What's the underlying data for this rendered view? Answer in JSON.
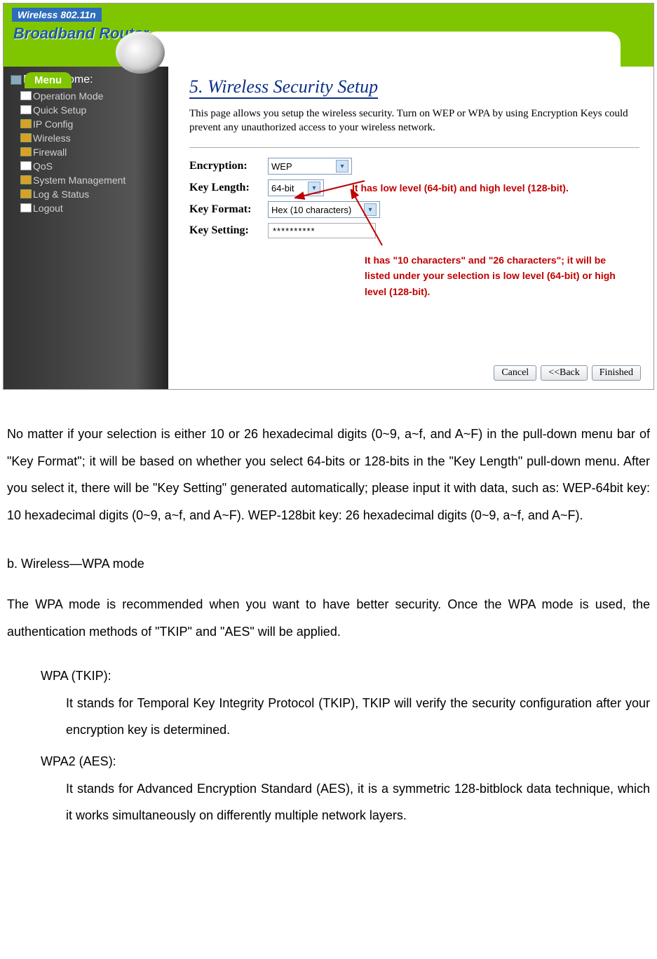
{
  "banner": {
    "line1": "Wireless 802.11n",
    "line2": "Broadband Router",
    "menu_label": "Menu"
  },
  "sidebar": {
    "title": "Router Home:",
    "items": [
      {
        "label": "Operation Mode",
        "icon": "page"
      },
      {
        "label": "Quick Setup",
        "icon": "page"
      },
      {
        "label": "IP Config",
        "icon": "folder"
      },
      {
        "label": "Wireless",
        "icon": "folder"
      },
      {
        "label": "Firewall",
        "icon": "folder"
      },
      {
        "label": "QoS",
        "icon": "page"
      },
      {
        "label": "System Management",
        "icon": "folder"
      },
      {
        "label": "Log & Status",
        "icon": "folder"
      },
      {
        "label": "Logout",
        "icon": "page"
      }
    ]
  },
  "section": {
    "title": "5. Wireless Security Setup",
    "description": "This page allows you setup the wireless security. Turn on WEP or WPA by using Encryption Keys could prevent any unauthorized access to your wireless network."
  },
  "form": {
    "encryption": {
      "label": "Encryption:",
      "value": "WEP"
    },
    "key_length": {
      "label": "Key Length:",
      "value": "64-bit"
    },
    "key_format": {
      "label": "Key Format:",
      "value": "Hex (10 characters)"
    },
    "key_setting": {
      "label": "Key Setting:",
      "value": "**********"
    }
  },
  "callouts": {
    "c1": "It has low level (64-bit) and high level (128-bit).",
    "c2": "It has \"10 characters\" and \"26 characters\"; it will be listed under your selection is low level (64-bit) or high level (128-bit)."
  },
  "buttons": {
    "cancel": "Cancel",
    "back": "<<Back",
    "finished": "Finished"
  },
  "doc": {
    "p1": "No matter if your selection is either 10 or 26 hexadecimal digits (0~9, a~f, and A~F) in the pull-down menu bar of \"Key Format\"; it will be based on whether you select 64-bits or 128-bits in the \"Key Length\" pull-down menu. After you select it, there will be \"Key Setting\" generated automatically; please input it with data, such as: WEP-64bit key: 10 hexadecimal digits (0~9, a~f, and A~F). WEP-128bit key: 26 hexadecimal digits (0~9, a~f, and A~F).",
    "h_b": "b. Wireless—WPA mode",
    "p2": "The WPA mode is recommended when you want to have better security. Once the WPA mode is used, the authentication methods of \"TKIP\" and \"AES\" will be applied.",
    "wpa_tkip_h": "WPA (TKIP):",
    "wpa_tkip_b": "It stands for Temporal Key Integrity Protocol (TKIP), TKIP will verify the security configuration after your encryption key is determined.",
    "wpa2_aes_h": "WPA2 (AES):",
    "wpa2_aes_b": "It stands for Advanced Encryption Standard (AES), it is a symmetric 128-bitblock data technique, which it works simultaneously on differently multiple network layers."
  }
}
